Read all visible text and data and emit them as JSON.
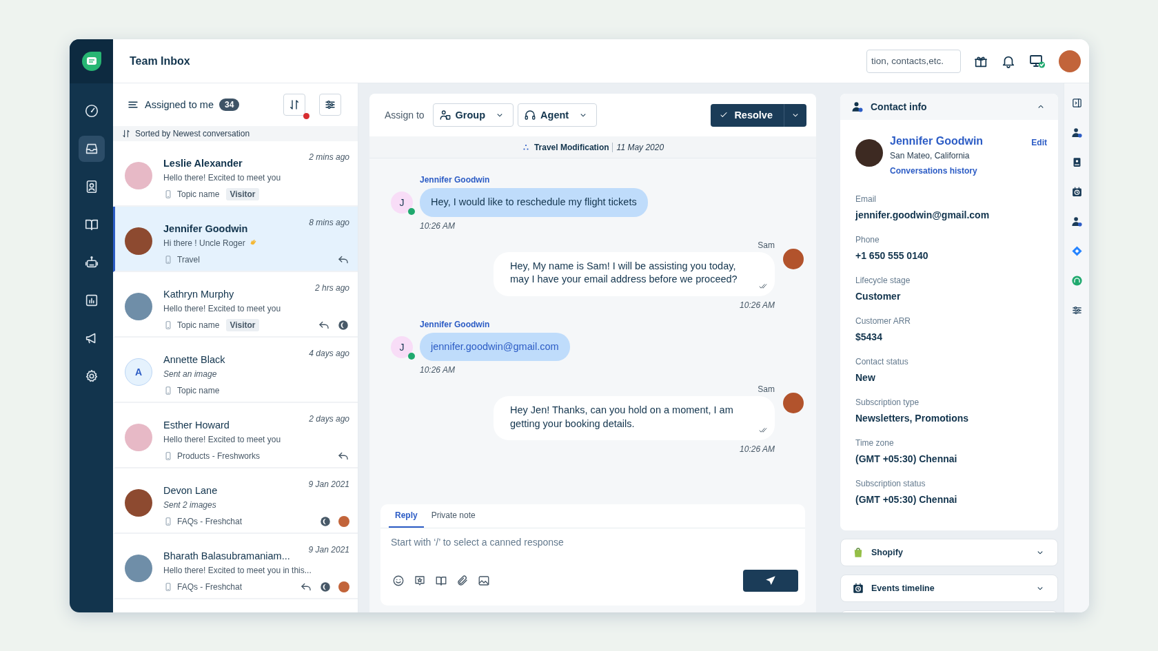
{
  "app": {
    "title": "Team Inbox",
    "search": {
      "placeholder": "tion, contacts,etc."
    }
  },
  "nav": [
    {
      "kind": "dashboard",
      "selected": false
    },
    {
      "kind": "inbox",
      "selected": true
    },
    {
      "kind": "contacts",
      "selected": false
    },
    {
      "kind": "knowledge",
      "selected": false
    },
    {
      "kind": "bots",
      "selected": false
    },
    {
      "kind": "reports",
      "selected": false
    },
    {
      "kind": "campaigns",
      "selected": false
    },
    {
      "kind": "settings",
      "selected": false
    }
  ],
  "list": {
    "filter": "Assigned to me",
    "count": "34",
    "sort_changed": true,
    "sort_note": "Sorted by Newest conversation"
  },
  "conversations": [
    {
      "name": "Leslie Alexander",
      "time": "2 mins ago",
      "preview": "Hello there! Excited to meet you",
      "kind": "text",
      "topic": "Topic name",
      "tag": "Visitor",
      "avatar": {
        "kind": "photo"
      },
      "unread": true,
      "selected": false
    },
    {
      "name": "Jennifer Goodwin",
      "time": "8 mins ago",
      "preview": "Hi there ! Uncle Roger",
      "wave": true,
      "kind": "text",
      "topic": "Travel",
      "avatar": {
        "kind": "photo"
      },
      "unread": true,
      "selected": true,
      "status_icons": [
        {
          "kind": "replied"
        }
      ]
    },
    {
      "name": "Kathryn Murphy",
      "time": "2 hrs ago",
      "preview": "Hello there! Excited to meet you",
      "kind": "text",
      "topic": "Topic name",
      "tag": "Visitor",
      "avatar": {
        "kind": "photo"
      },
      "unread": false,
      "selected": false,
      "status_icons": [
        {
          "kind": "replied"
        },
        {
          "kind": "snoozed"
        }
      ]
    },
    {
      "name": "Annette Black",
      "time": "4 days ago",
      "preview": "Sent an image",
      "kind": "media",
      "topic": "Topic name",
      "avatar": {
        "kind": "initial",
        "text": "A"
      },
      "unread": false,
      "selected": false
    },
    {
      "name": "Esther Howard",
      "time": "2 days ago",
      "preview": "Hello there! Excited to meet you",
      "kind": "text",
      "topic": "Products - Freshworks",
      "avatar": {
        "kind": "photo"
      },
      "unread": false,
      "selected": false,
      "status_icons": [
        {
          "kind": "replied"
        }
      ]
    },
    {
      "name": "Devon Lane",
      "time": "9 Jan 2021",
      "preview": "Sent 2 images",
      "kind": "media",
      "topic": "FAQs - Freshchat",
      "avatar": {
        "kind": "photo"
      },
      "unread": false,
      "selected": false,
      "status_icons": [
        {
          "kind": "snoozed"
        },
        {
          "kind": "agent"
        }
      ]
    },
    {
      "name": "Bharath Balasubramaniam...",
      "time": "9 Jan 2021",
      "preview": "Hello there! Excited to meet you in this...",
      "kind": "text",
      "topic": "FAQs - Freshchat",
      "avatar": {
        "kind": "photo"
      },
      "unread": false,
      "selected": false,
      "status_icons": [
        {
          "kind": "replied"
        },
        {
          "kind": "snoozed"
        },
        {
          "kind": "agent"
        }
      ]
    }
  ],
  "chat": {
    "assign_label": "Assign to",
    "group": "Group",
    "agent": "Agent",
    "resolve": "Resolve",
    "topic": "Travel Modification",
    "date": "11 May 2020",
    "customer_online": true,
    "messages": [
      {
        "kind": "customer_text",
        "sender": "Jennifer Goodwin",
        "initial": "J",
        "text": "Hey, I would like to reschedule my flight tickets",
        "time": "10:26 AM"
      },
      {
        "kind": "agent_text",
        "sender": "Sam",
        "text": "Hey, My name is Sam! I will be assisting you today, may I have your email address before we proceed?",
        "time": "10:26 AM",
        "delivered": true
      },
      {
        "kind": "customer_email",
        "sender": "Jennifer Goodwin",
        "initial": "J",
        "text": "jennifer.goodwin@gmail.com",
        "time": "10:26 AM"
      },
      {
        "kind": "agent_text",
        "sender": "Sam",
        "text": "Hey Jen! Thanks, can you hold on a moment, I am getting your booking details.",
        "time": "10:26 AM",
        "delivered": true
      }
    ]
  },
  "composer": {
    "tabs": [
      {
        "label": "Reply",
        "selected": true
      },
      {
        "label": "Private note",
        "selected": false
      }
    ],
    "placeholder": "Start with ‘/’ to select a canned response",
    "tools": [
      {
        "kind": "emoji"
      },
      {
        "kind": "canned"
      },
      {
        "kind": "knowledge"
      },
      {
        "kind": "attach"
      },
      {
        "kind": "image"
      }
    ]
  },
  "contact": {
    "title": "Contact info",
    "expanded": true,
    "name": "Jennifer Goodwin",
    "location": "San Mateo, California",
    "edit": "Edit",
    "history": "Conversations history",
    "fields": [
      {
        "label": "Email",
        "value": "jennifer.goodwin@gmail.com"
      },
      {
        "label": "Phone",
        "value": "+1 650 555 0140"
      },
      {
        "label": "Lifecycle stage",
        "value": "Customer"
      },
      {
        "label": "Customer ARR",
        "value": "$5434"
      },
      {
        "label": "Contact status",
        "value": "New"
      },
      {
        "label": "Subscription type",
        "value": "Newsletters, Promotions"
      },
      {
        "label": "Time zone",
        "value": "(GMT +05:30) Chennai"
      },
      {
        "label": "Subscription status",
        "value": "(GMT +05:30) Chennai"
      }
    ]
  },
  "panels": [
    {
      "kind": "shopify",
      "title": "Shopify",
      "expanded": false
    },
    {
      "kind": "events",
      "title": "Events timeline",
      "expanded": false
    }
  ],
  "rail": [
    {
      "kind": "collapse"
    },
    {
      "kind": "contact"
    },
    {
      "kind": "card"
    },
    {
      "kind": "events"
    },
    {
      "kind": "contact"
    },
    {
      "kind": "jira"
    },
    {
      "kind": "headset_app"
    },
    {
      "kind": "sliders"
    }
  ]
}
